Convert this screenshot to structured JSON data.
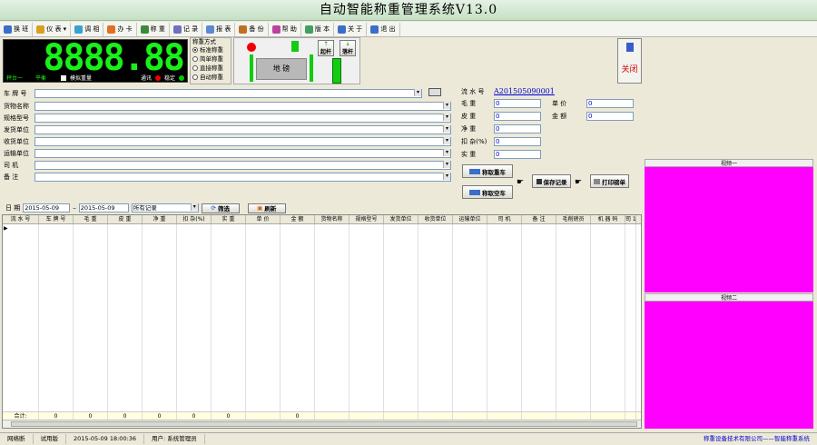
{
  "window_title": "自动智能称重管理系统V13.0",
  "toolbar": [
    "换 班",
    "仪 表 ▾",
    "调 相",
    "办 卡",
    "称 重",
    "记 录",
    "报 表",
    "备 份",
    "帮 助",
    "版 本",
    "关 于",
    "退 出"
  ],
  "toolbar_colors": [
    "#3a6ec8",
    "#d8a020",
    "#3aa0d0",
    "#e07020",
    "#3a8a3a",
    "#7070c0",
    "#5a8ad0",
    "#c07020",
    "#c040a0",
    "#40a060",
    "#3a6ec8",
    "#3a6ec8"
  ],
  "led": {
    "value": "8888.88",
    "status_left": "秤台一",
    "status_mid": "平衡",
    "sim_label": "模拟重量",
    "comm_label": "通讯",
    "stable_label": "稳定"
  },
  "weigh_mode": {
    "title": "称重方式",
    "options": [
      "标准称重",
      "简单称重",
      "直接称重",
      "自动称重"
    ],
    "selected": 0
  },
  "scale": {
    "label": "地    磅",
    "lift_label": "起杆",
    "drop_label": "落杆"
  },
  "close_label": "关闭",
  "form": {
    "labels": [
      "车 牌 号",
      "货物名称",
      "规格型号",
      "发货单位",
      "收货单位",
      "运输单位",
      "司    机",
      "备    注"
    ]
  },
  "right_form": {
    "serial_label": "流 水 号",
    "serial_value": "A201505090001",
    "gross_label": "毛    重",
    "gross_value": "0",
    "price_label": "单    价",
    "price_value": "0",
    "tare_label": "皮    重",
    "tare_value": "0",
    "amount_label": "金    额",
    "amount_value": "0",
    "net_label": "净    重",
    "net_value": "0",
    "deduct_label": "扣 杂(%)",
    "deduct_value": "0",
    "actual_label": "实    重",
    "actual_value": "0"
  },
  "buttons": {
    "heavy": "称取重车",
    "empty": "称取空车",
    "save": "保存记录",
    "print": "打印磅单"
  },
  "filter": {
    "date_label": "日 期",
    "from": "2015-05-09",
    "to": "2015-05-09",
    "scope": "所有记录",
    "filter_btn": "筛选",
    "refresh_btn": "刷新"
  },
  "table": {
    "columns": [
      "流 水 号",
      "车 牌 号",
      "毛    重",
      "皮    重",
      "净    重",
      "扣 杂(%)",
      "实    重",
      "单    价",
      "金    额",
      "货物名称",
      "规格型号",
      "发货单位",
      "收货单位",
      "运输单位",
      "司    机",
      "备    注",
      "毛削磅员",
      "机 器 码",
      "司 1"
    ],
    "totals": [
      "合计:",
      "0",
      "0",
      "0",
      "0",
      "0",
      "0",
      "",
      "0",
      "",
      "",
      "",
      "",
      "",
      "",
      "",
      "",
      "",
      ""
    ]
  },
  "video": {
    "one": "视频一",
    "two": "视频二"
  },
  "statusbar": [
    "网络断",
    "试用版",
    "2015-05-09 18:00:36",
    "用户: 系统管理员",
    "称重设备技术有限公司——智能称重系统"
  ]
}
